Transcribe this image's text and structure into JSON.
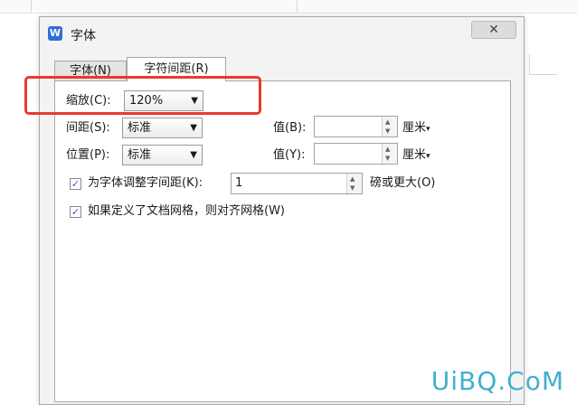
{
  "app": {
    "window_title": "字体",
    "icon_glyph": "W",
    "close_glyph": "✕"
  },
  "tabs": [
    {
      "label": "字体(N)"
    },
    {
      "label": "字符间距(R)"
    }
  ],
  "scale": {
    "label": "缩放(C):",
    "value": "120%"
  },
  "spacing": {
    "label": "间距(S):",
    "value": "标准",
    "value_label": "值(B):",
    "value_text": "",
    "unit": "厘米"
  },
  "position": {
    "label": "位置(P):",
    "value": "标准",
    "value_label": "值(Y):",
    "value_text": "",
    "unit": "厘米"
  },
  "kerning": {
    "label": "为字体调整字间距(K):",
    "value": "1",
    "suffix": "磅或更大(O)",
    "checked": true
  },
  "grid": {
    "label": "如果定义了文档网格，则对齐网格(W)",
    "checked": true
  },
  "glyphs": {
    "dropdown_arrow": "▼",
    "spin_up": "▲",
    "spin_down": "▼",
    "unit_arrow": "▾",
    "check": "✓"
  },
  "watermark": "UiBQ.CoM",
  "colors": {
    "highlight_border": "#e83a2f",
    "watermark": "#3fb0cf",
    "app_icon": "#2f6fd6",
    "check": "#2a62c9"
  }
}
